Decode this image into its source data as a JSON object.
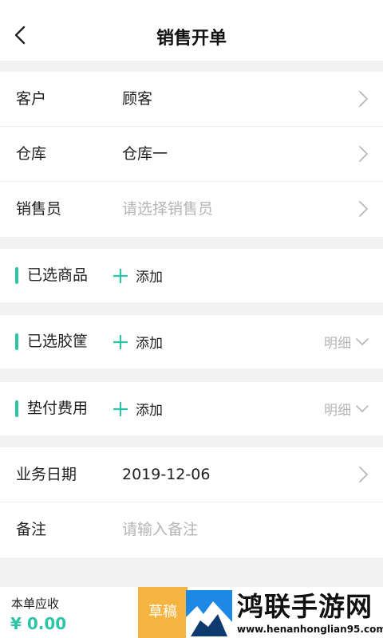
{
  "header": {
    "title": "销售开单"
  },
  "form_top": [
    {
      "label": "客户",
      "value": "顾客",
      "placeholder": false
    },
    {
      "label": "仓库",
      "value": "仓库一",
      "placeholder": false
    },
    {
      "label": "销售员",
      "value": "请选择销售员",
      "placeholder": true
    }
  ],
  "sections": {
    "goods": {
      "label": "已选商品",
      "add": "添加"
    },
    "baskets": {
      "label": "已选胶筐",
      "add": "添加",
      "detail": "明细"
    },
    "fees": {
      "label": "垫付费用",
      "add": "添加",
      "detail": "明细"
    }
  },
  "form_bottom": {
    "date": {
      "label": "业务日期",
      "value": "2019-12-06"
    },
    "remark": {
      "label": "备注",
      "placeholder": "请输入备注"
    }
  },
  "footer": {
    "due_label": "本单应收",
    "due_amount": "¥ 0.00",
    "draft_button": "草稿"
  },
  "watermark": {
    "title": "鸿联手游网",
    "url": "www.henanhonglian95.com"
  },
  "colors": {
    "accent": "#2ec4a8",
    "draft": "#f5b43f",
    "placeholder": "#b5b5b5",
    "background": "#f2f2f2"
  }
}
